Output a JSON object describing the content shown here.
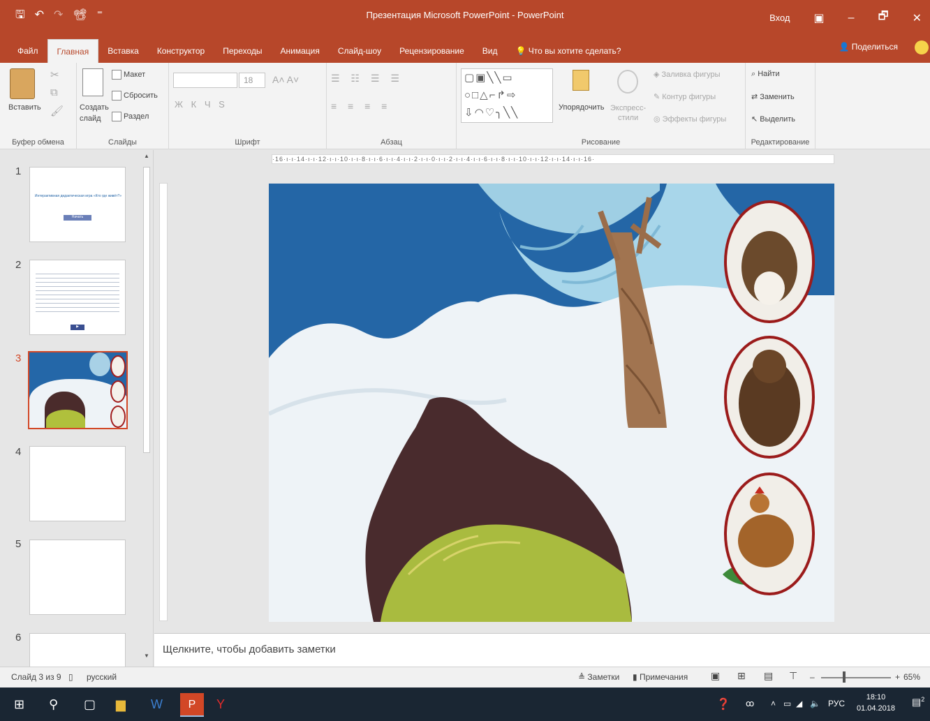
{
  "window": {
    "title": "Презентация Microsoft PowerPoint - PowerPoint",
    "signin": "Вход",
    "minimize": "–",
    "maximize": "🗗",
    "close": "✕"
  },
  "qat": {
    "save": "🖫",
    "undo": "↶",
    "redo": "↷",
    "slideshow": "📽",
    "more": "⁼"
  },
  "tabs": [
    "Файл",
    "Главная",
    "Вставка",
    "Конструктор",
    "Переходы",
    "Анимация",
    "Слайд-шоу",
    "Рецензирование",
    "Вид"
  ],
  "active_tab": "Главная",
  "tell_me": "Что вы хотите сделать?",
  "share": "Поделиться",
  "ribbon": {
    "clipboard": {
      "paste": "Вставить",
      "label": "Буфер обмена"
    },
    "slides": {
      "new_slide": "Создать",
      "new_slide_2": "слайд",
      "layout": "Макет",
      "reset": "Сбросить",
      "section": "Раздел",
      "label": "Слайды"
    },
    "font": {
      "size": "18",
      "bold": "Ж",
      "italic": "К",
      "underline": "Ч",
      "strike": "S",
      "label": "Шрифт"
    },
    "paragraph": {
      "label": "Абзац"
    },
    "drawing": {
      "arrange": "Упорядочить",
      "quick_styles": "Экспресс-",
      "quick_styles_2": "стили",
      "fill": "Заливка фигуры",
      "outline": "Контур фигуры",
      "effects": "Эффекты фигуры",
      "label": "Рисование"
    },
    "editing": {
      "find": "Найти",
      "replace": "Заменить",
      "select": "Выделить",
      "label": "Редактирование"
    }
  },
  "ruler": "·16·ı·ı·14·ı·ı·12·ı·ı·10·ı·ı·8·ı·ı·6·ı·ı·4·ı·ı·2·ı·ı·0·ı·ı·2·ı·ı·4·ı·ı·6·ı·ı·8·ı·ı·10·ı·ı·12·ı·ı·14·ı·ı·16·",
  "thumbnails": [
    {
      "num": "1",
      "title": "Интерактивная дидактическая игра «Кто где живёт?»",
      "button": "Начать"
    },
    {
      "num": "2",
      "button": "▶"
    },
    {
      "num": "3"
    },
    {
      "num": "4"
    },
    {
      "num": "5"
    },
    {
      "num": "6"
    }
  ],
  "notes_placeholder": "Щелкните, чтобы добавить заметки",
  "status": {
    "slide": "Слайд 3 из 9",
    "language": "русский",
    "notes": "Заметки",
    "comments": "Примечания",
    "zoom": "65%",
    "zoom_level": 0.65
  },
  "taskbar": {
    "time": "18:10",
    "date": "01.04.2018",
    "lang": "РУС",
    "notifications": "2"
  },
  "colors": {
    "accent": "#b7472a",
    "ribbon": "#f3f3f3",
    "taskbar": "#1a2633"
  }
}
